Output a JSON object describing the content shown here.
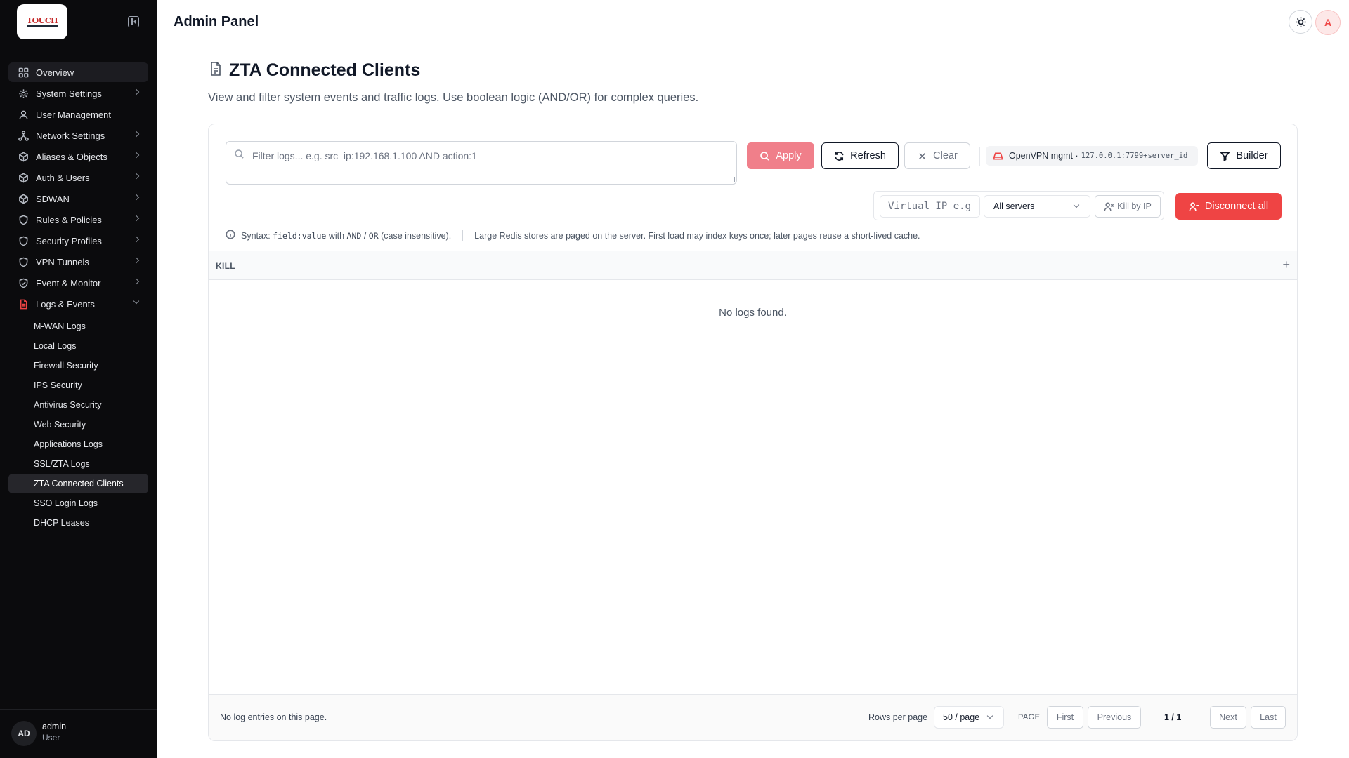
{
  "sidebar": {
    "logo_text": "TOUCH",
    "items": [
      {
        "label": "Overview",
        "icon": "grid-icon",
        "active": true
      },
      {
        "label": "System Settings",
        "icon": "gear-icon",
        "chevron": true
      },
      {
        "label": "User Management",
        "icon": "user-icon"
      },
      {
        "label": "Network Settings",
        "icon": "network-icon",
        "chevron": true
      },
      {
        "label": "Aliases & Objects",
        "icon": "cube-icon",
        "chevron": true
      },
      {
        "label": "Auth & Users",
        "icon": "cube-icon",
        "chevron": true
      },
      {
        "label": "SDWAN",
        "icon": "cube-icon",
        "chevron": true
      },
      {
        "label": "Rules & Policies",
        "icon": "shield-icon",
        "chevron": true
      },
      {
        "label": "Security Profiles",
        "icon": "shield-icon",
        "chevron": true
      },
      {
        "label": "VPN Tunnels",
        "icon": "shield-icon",
        "chevron": true
      },
      {
        "label": "Event & Monitor",
        "icon": "shield-check-icon",
        "chevron": true
      },
      {
        "label": "Logs & Events",
        "icon": "file-icon",
        "open": true
      }
    ],
    "sub_items": [
      {
        "label": "M-WAN Logs"
      },
      {
        "label": "Local Logs"
      },
      {
        "label": "Firewall Security"
      },
      {
        "label": "IPS Security"
      },
      {
        "label": "Antivirus Security"
      },
      {
        "label": "Web Security"
      },
      {
        "label": "Applications Logs"
      },
      {
        "label": "SSL/ZTA Logs"
      },
      {
        "label": "ZTA Connected Clients",
        "active": true
      },
      {
        "label": "SSO Login Logs"
      },
      {
        "label": "DHCP Leases"
      }
    ],
    "user": {
      "initials": "AD",
      "name": "admin",
      "role": "User"
    }
  },
  "topbar": {
    "title": "Admin Panel",
    "avatar": "A"
  },
  "page": {
    "title": "ZTA Connected Clients",
    "description": "View and filter system events and traffic logs. Use boolean logic (AND/OR) for complex queries."
  },
  "filter": {
    "placeholder": "Filter logs... e.g. src_ip:192.168.1.100 AND action:1",
    "apply_label": "Apply",
    "refresh_label": "Refresh",
    "clear_label": "Clear",
    "source_label": "OpenVPN mgmt ·",
    "source_addr": "127.0.0.1:7799+server_id",
    "builder_label": "Builder"
  },
  "tools": {
    "vip_placeholder": "Virtual IP e.g",
    "server_select": "All servers",
    "kill_ip_label": "Kill by IP",
    "disconnect_label": "Disconnect all"
  },
  "syntax": {
    "prefix": "Syntax:",
    "field": "field:value",
    "with": "with",
    "and": "AND",
    "slash": "/",
    "or": "OR",
    "suffix": "(case insensitive).",
    "note": "Large Redis stores are paged on the server. First load may index keys once; later pages reuse a short-lived cache."
  },
  "table": {
    "columns": [
      "KILL"
    ],
    "add_column": "+",
    "empty": "No logs found."
  },
  "footer": {
    "status": "No log entries on this page.",
    "rows_label": "Rows per page",
    "rows_value": "50 / page",
    "page_label": "PAGE",
    "first": "First",
    "previous": "Previous",
    "page_count": "1 / 1",
    "next": "Next",
    "last": "Last"
  },
  "colors": {
    "accent": "#ef4444",
    "apply_disabled": "#f07f8a",
    "sidebar_bg": "#0b0b0d"
  }
}
